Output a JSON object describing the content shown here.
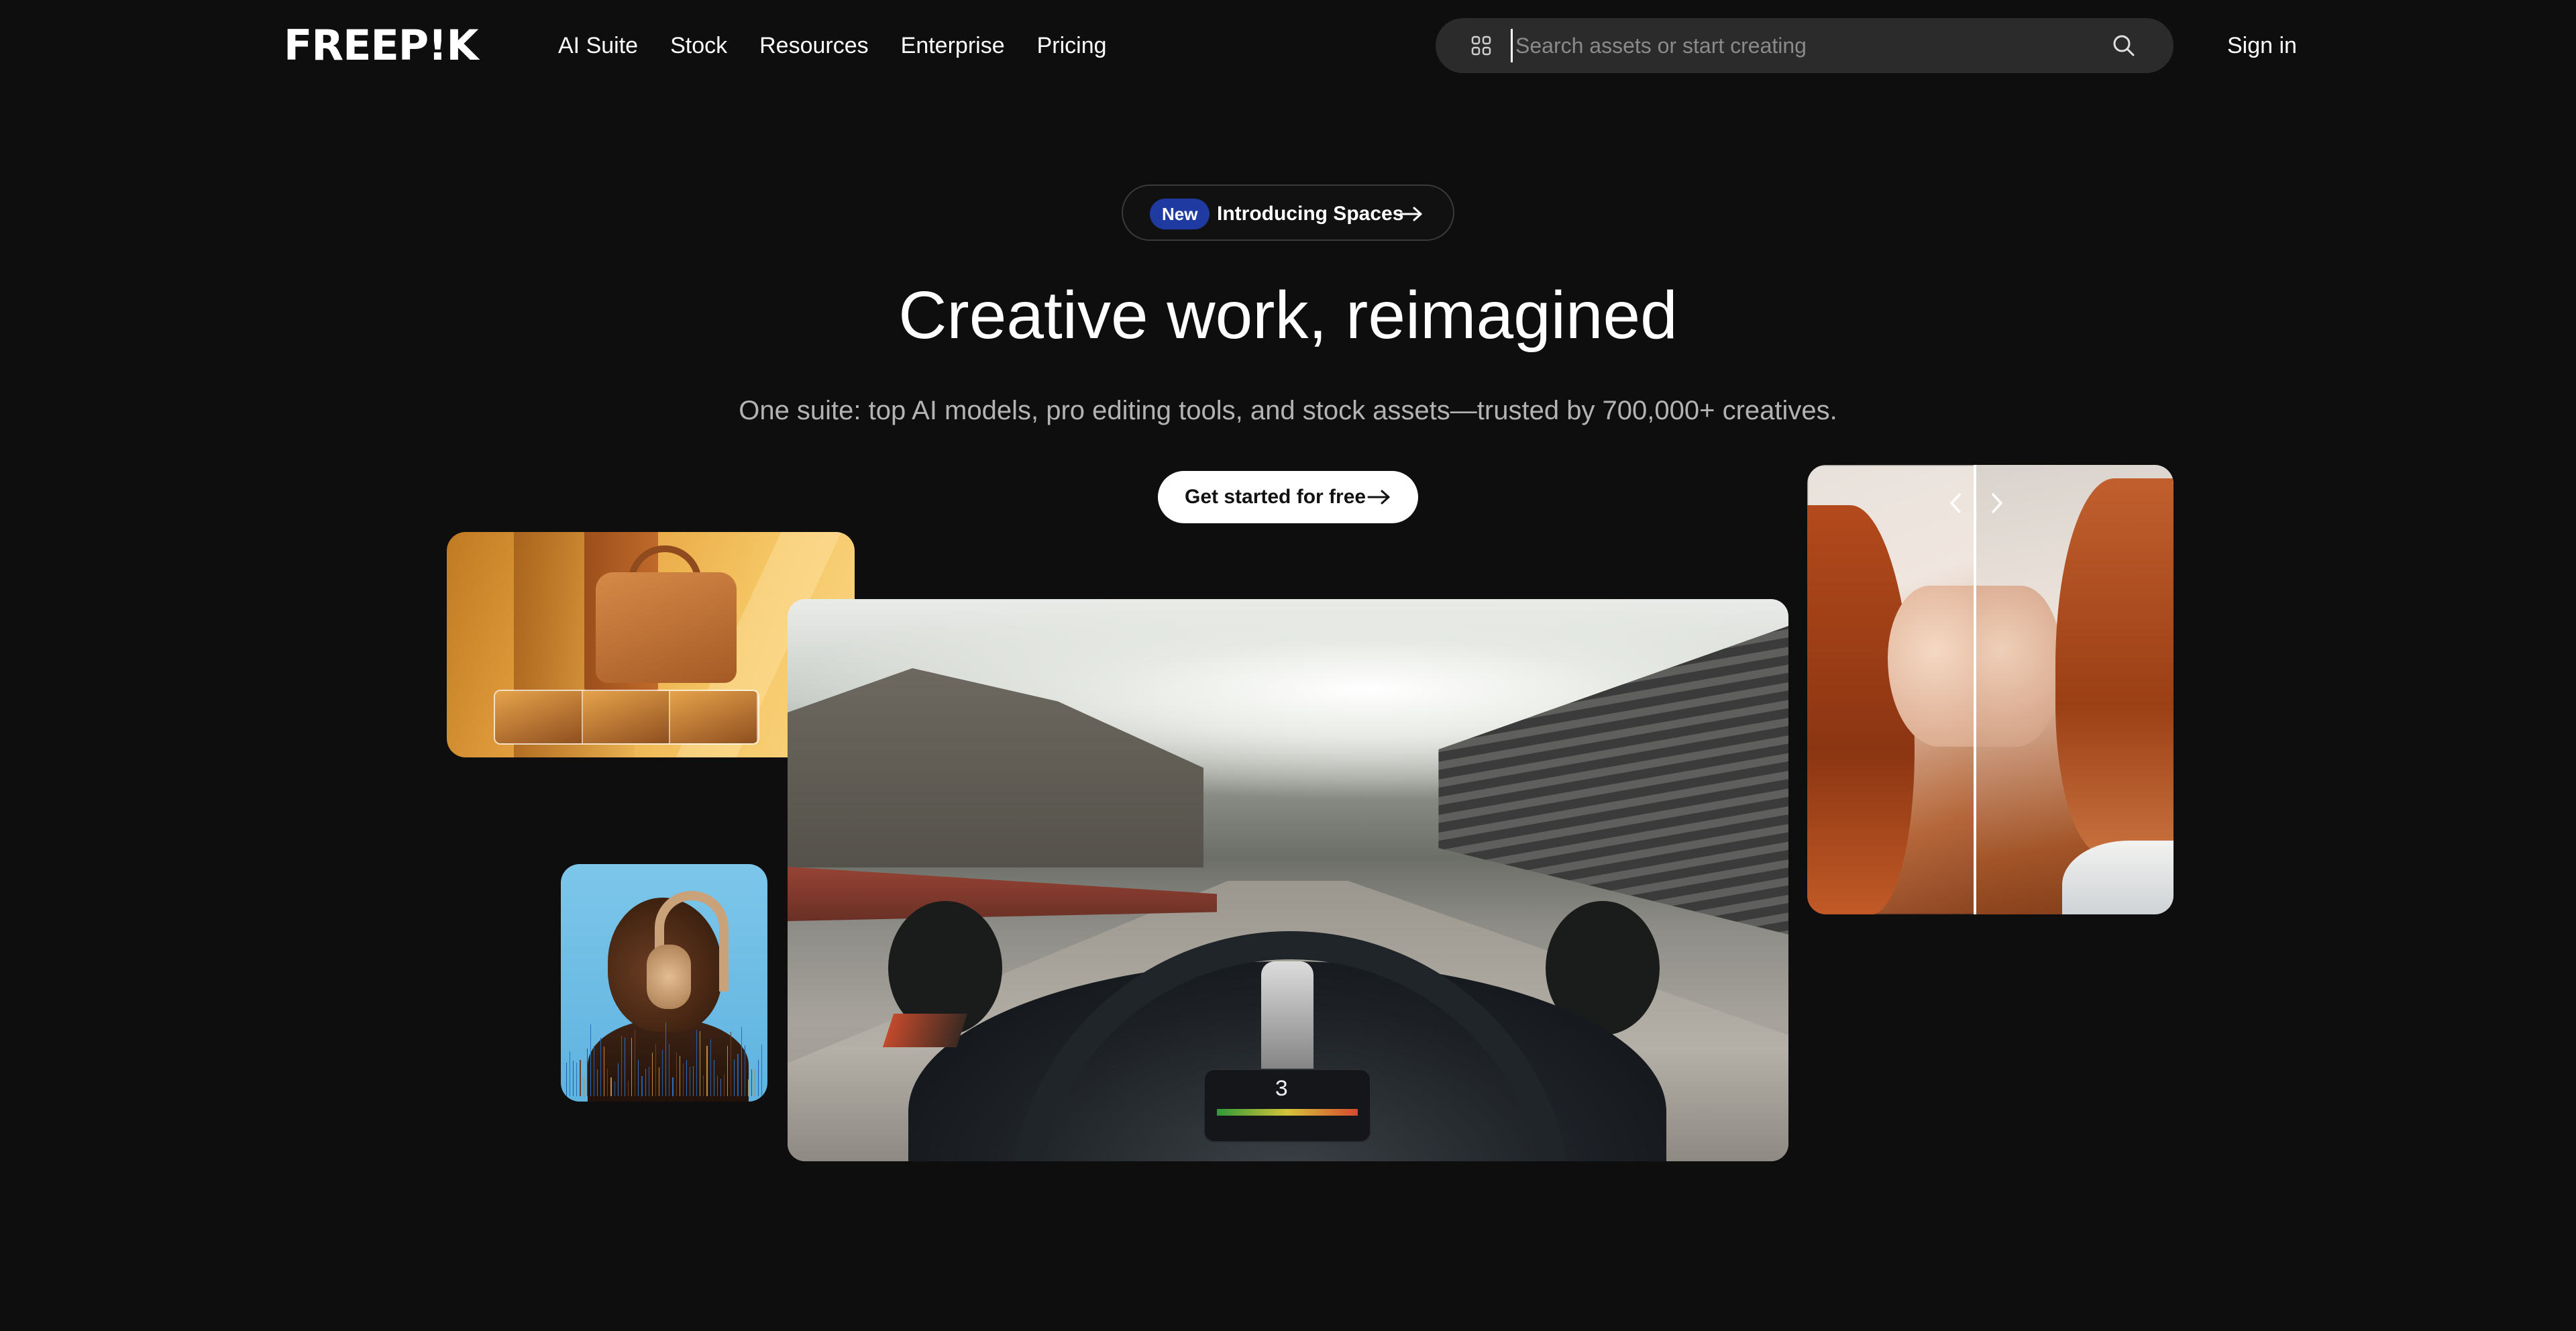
{
  "header": {
    "logo": "FREEP!K",
    "nav": [
      "AI Suite",
      "Stock",
      "Resources",
      "Enterprise",
      "Pricing"
    ],
    "search_placeholder": "Search assets or start creating",
    "sign_in": "Sign in"
  },
  "hero": {
    "badge": "New",
    "announcement": "Introducing Spaces",
    "title": "Creative work, reimagined",
    "subtitle": "One suite: top AI models, pro editing tools, and stock assets—trusted by 700,000+ creatives.",
    "cta": "Get started for free"
  },
  "media": {
    "race_gear": "3"
  },
  "icons": {
    "search": "search-icon",
    "apps": "grid-icon",
    "arrow": "arrow-right-icon",
    "prev": "chevron-left-icon",
    "next": "chevron-right-icon"
  },
  "colors": {
    "background": "#0e0e0e",
    "badge": "#1f3aa0",
    "search_bg": "#2b2b2b"
  }
}
